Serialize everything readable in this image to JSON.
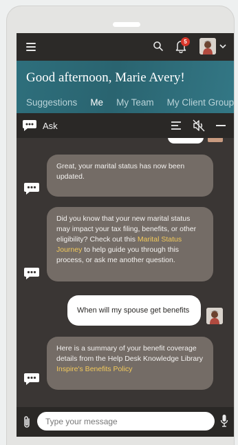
{
  "header": {
    "greeting": "Good afternoon, Marie Avery!",
    "notification_count": "5",
    "tabs": [
      {
        "label": "Suggestions",
        "active": false
      },
      {
        "label": "Me",
        "active": true
      },
      {
        "label": "My Team",
        "active": false
      },
      {
        "label": "My Client Group",
        "active": false
      }
    ]
  },
  "ask_bar": {
    "label": "Ask"
  },
  "messages": {
    "m1": {
      "text": "Great, your marital status has now been updated."
    },
    "m2": {
      "text_before": "Did you know that your new marital status may impact your tax filing, benefits, or other eligibility? Check out this ",
      "link": "Marital Status Journey",
      "text_after": " to help guide you through this process, or ask me another question."
    },
    "m3": {
      "text": "When will my spouse get benefits"
    },
    "m4": {
      "text_before": "Here is a summary of your benefit coverage details from the Help Desk Knowledge Library ",
      "link": "Inspire's Benefits Policy"
    }
  },
  "input": {
    "placeholder": "Type your message"
  },
  "colors": {
    "banner": "#2e6f7c",
    "chat_bg": "#3a3634",
    "bot_bubble": "#746c66",
    "link": "#f2c95b",
    "badge": "#d9372b"
  }
}
